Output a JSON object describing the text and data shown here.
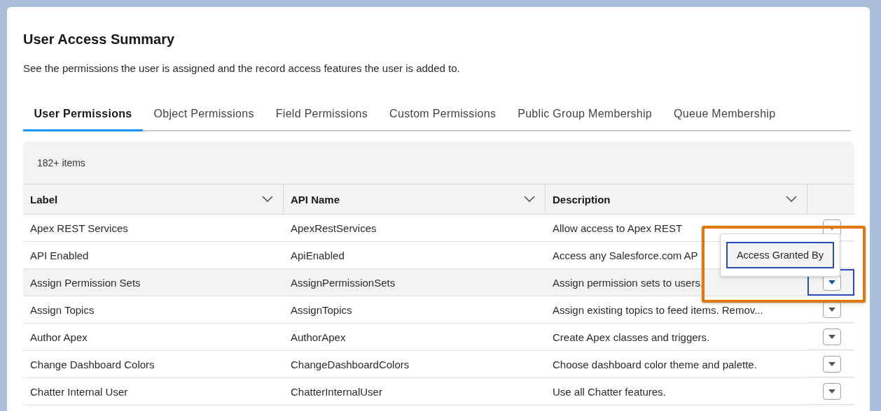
{
  "title": "User Access Summary",
  "description": "See the permissions the user is assigned and the record access features the user is added to.",
  "tabs": [
    {
      "label": "User Permissions",
      "selected": true
    },
    {
      "label": "Object Permissions",
      "selected": false
    },
    {
      "label": "Field Permissions",
      "selected": false
    },
    {
      "label": "Custom Permissions",
      "selected": false
    },
    {
      "label": "Public Group Membership",
      "selected": false
    },
    {
      "label": "Queue Membership",
      "selected": false
    }
  ],
  "table": {
    "count": "182+ items",
    "columns": [
      {
        "label": "Label"
      },
      {
        "label": "API Name"
      },
      {
        "label": "Description"
      }
    ],
    "rows": [
      {
        "label": "Apex REST Services",
        "api_name": "ApexRestServices",
        "description": "Allow access to Apex REST",
        "selected": false
      },
      {
        "label": "API Enabled",
        "api_name": "ApiEnabled",
        "description": "Access any Salesforce.com AP",
        "selected": false,
        "action_hidden": true
      },
      {
        "label": "Assign Permission Sets",
        "api_name": "AssignPermissionSets",
        "description": "Assign permission sets to users.",
        "selected": true
      },
      {
        "label": "Assign Topics",
        "api_name": "AssignTopics",
        "description": "Assign existing topics to feed items. Remov...",
        "selected": false
      },
      {
        "label": "Author Apex",
        "api_name": "AuthorApex",
        "description": "Create Apex classes and triggers.",
        "selected": false
      },
      {
        "label": "Change Dashboard Colors",
        "api_name": "ChangeDashboardColors",
        "description": "Choose dashboard color theme and palette.",
        "selected": false
      },
      {
        "label": "Chatter Internal User",
        "api_name": "ChatterInternalUser",
        "description": "Use all Chatter features.",
        "selected": false
      }
    ]
  },
  "menu": {
    "items": [
      {
        "label": "Access Granted By",
        "selected": true
      }
    ]
  }
}
